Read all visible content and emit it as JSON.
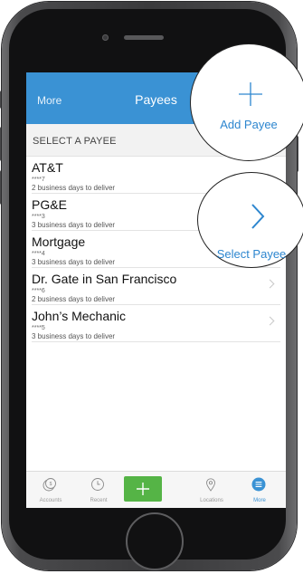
{
  "nav": {
    "back_label": "More",
    "title": "Payees"
  },
  "section_header": "SELECT A PAYEE",
  "payees": [
    {
      "name": "AT&T",
      "account": "****7",
      "delivery": "2 business days to deliver"
    },
    {
      "name": "PG&E",
      "account": "****3",
      "delivery": "3 business days to deliver"
    },
    {
      "name": "Mortgage",
      "account": "****4",
      "delivery": "3 business days to deliver"
    },
    {
      "name": "Dr. Gate in San Francisco",
      "account": "****6",
      "delivery": "2 business days to deliver"
    },
    {
      "name": "John’s Mechanic",
      "account": "****5",
      "delivery": "3 business days to deliver"
    }
  ],
  "callouts": {
    "add_payee": "Add Payee",
    "select_payee": "Select Payee"
  },
  "tabbar": [
    {
      "label": "Accounts",
      "icon": "accounts-icon"
    },
    {
      "label": "Recent",
      "icon": "clock-icon"
    },
    {
      "label": "",
      "icon": "plus-icon"
    },
    {
      "label": "Locations",
      "icon": "location-pin-icon"
    },
    {
      "label": "More",
      "icon": "more-icon"
    }
  ],
  "colors": {
    "accent": "#3a92d4",
    "add_button": "#55b446",
    "callout_text": "#2d86cf"
  }
}
